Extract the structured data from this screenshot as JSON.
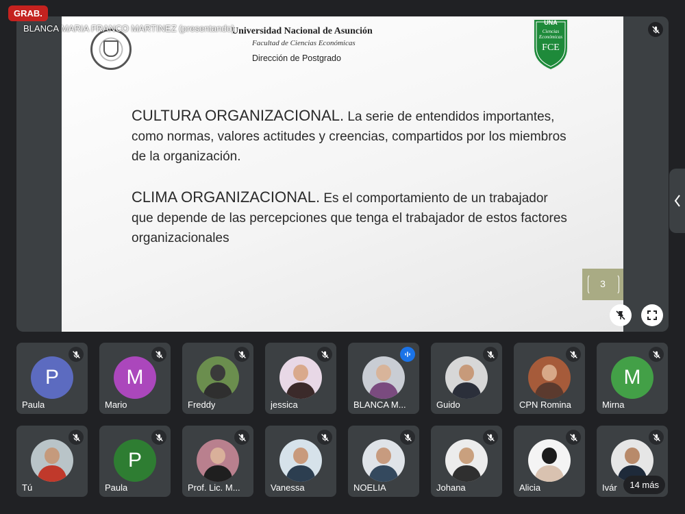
{
  "recording_badge": "GRAB.",
  "presenter": {
    "name": "BLANCA MARIA FRANCO MARTINEZ (presentando)"
  },
  "slide": {
    "university": "Universidad Nacional de Asunción",
    "faculty": "Facultad de Ciencias Económicas",
    "department": "Dirección de Postgrado",
    "logo_top": "UNA",
    "logo_sub": "Ciencias\nEconómicas",
    "logo_text": "FCE",
    "paragraphs": [
      {
        "term": "CULTURA ORGANIZACIONAL.",
        "text": " La serie de entendidos importantes, como normas, valores actitudes y creencias, compartidos por los miembros de la organización."
      },
      {
        "term": "CLIMA ORGANIZACIONAL.",
        "text": " Es el comportamiento de un trabajador que depende de las percepciones que tenga el trabajador de estos factores organizacionales"
      }
    ],
    "page_number": "3"
  },
  "participants_row1": [
    {
      "name": "Paula",
      "initial": "P",
      "color": "#5c6bc0"
    },
    {
      "name": "Mario",
      "initial": "M",
      "color": "#ab47bc"
    },
    {
      "name": "Freddy",
      "photo_bg": "#6b8e4e",
      "head": "#3a3a3a",
      "body": "#2f2f2f"
    },
    {
      "name": "jessica",
      "photo_bg": "#e8d8e6",
      "head": "#d9a98c",
      "body": "#3b2a2a"
    },
    {
      "name": "BLANCA M...",
      "photo_bg": "#c9cdd4",
      "head": "#d8b49a",
      "body": "#7a4b7f",
      "speaking": true
    },
    {
      "name": "Guido",
      "photo_bg": "#d7d7d7",
      "head": "#c79a7a",
      "body": "#2b2f3a"
    },
    {
      "name": "CPN Romina",
      "photo_bg": "#a65b3a",
      "head": "#d7a888",
      "body": "#5b3a2e"
    },
    {
      "name": "Mirna",
      "initial": "M",
      "color": "#43a047"
    }
  ],
  "participants_row2": [
    {
      "name": "Tú",
      "photo_bg": "#b9c4c8",
      "head": "#c59a7c",
      "body": "#c0392b"
    },
    {
      "name": "Paula",
      "initial": "P",
      "color": "#2e7d32"
    },
    {
      "name": "Prof. Lic. M...",
      "photo_bg": "#b9808e",
      "head": "#d9b09a",
      "body": "#1f1f1f"
    },
    {
      "name": "Vanessa",
      "photo_bg": "#d6e2ea",
      "head": "#c89a7c",
      "body": "#2c3e50"
    },
    {
      "name": "NOELIA",
      "photo_bg": "#dfe3e8",
      "head": "#c79b7f",
      "body": "#34495e"
    },
    {
      "name": "Johana",
      "photo_bg": "#ececec",
      "head": "#c9a07e",
      "body": "#2f2f2f"
    },
    {
      "name": "Alicia",
      "photo_bg": "#f4f4f4",
      "head": "#1c1c1c",
      "body": "#d9c2b0"
    },
    {
      "name": "Ivár",
      "photo_bg": "#e6e6e6",
      "head": "#b88a6a",
      "body": "#1e2a3a"
    }
  ],
  "more_participants": "14 más"
}
